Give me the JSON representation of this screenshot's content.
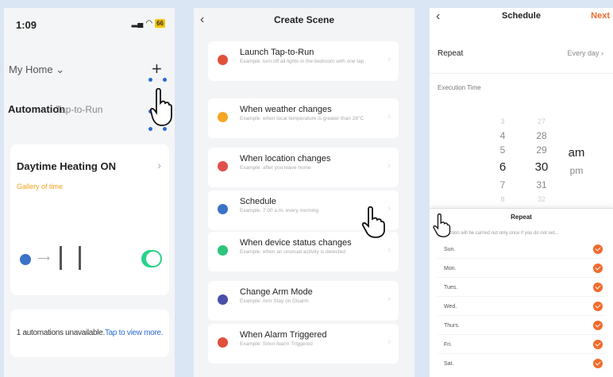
{
  "screen1": {
    "time": "1:09",
    "battery": "66",
    "home_label": "My Home",
    "add_icon": "+",
    "tabs": [
      "Automation",
      "Tap-to-Run"
    ],
    "automation": {
      "title": "Daytime Heating ON",
      "subtitle": "Gallery of time",
      "toggle_on": true
    },
    "unavailable": "1 automations unavailable.",
    "view_more": "Tap to view more."
  },
  "screen2": {
    "title": "Create Scene",
    "items": [
      {
        "title": "Launch Tap-to-Run",
        "desc": "Example: turn off all lights in the bedroom with one tap",
        "icon": "tap-icon",
        "color": "#e0503a"
      },
      {
        "title": "When weather changes",
        "desc": "Example: when local temperature is greater than 28°C",
        "icon": "sun-icon",
        "color": "#f5a623"
      },
      {
        "title": "When location changes",
        "desc": "Example: after you leave home",
        "icon": "location-icon",
        "color": "#e0504a"
      },
      {
        "title": "Schedule",
        "desc": "Example: 7:00 a.m. every morning",
        "icon": "clock-icon",
        "color": "#3a72c7"
      },
      {
        "title": "When device status changes",
        "desc": "Example: when an unusual activity is detected",
        "icon": "device-icon",
        "color": "#2bc47a"
      },
      {
        "title": "Change Arm Mode",
        "desc": "Example: Arm Stay on Disarm",
        "icon": "shield-icon",
        "color": "#4a4fa8"
      },
      {
        "title": "When Alarm Triggered",
        "desc": "Example: Siren Alarm Triggered",
        "icon": "alarm-icon",
        "color": "#e0503a"
      }
    ]
  },
  "screen3": {
    "title": "Schedule",
    "next": "Next",
    "repeat_label": "Repeat",
    "repeat_value": "Every day",
    "execution_time": "Execution Time",
    "hours": [
      "4",
      "5",
      "6",
      "7",
      "8"
    ],
    "minutes": [
      "28",
      "29",
      "30",
      "31",
      "32"
    ],
    "ampm": [
      "am",
      "pm"
    ],
    "selected": {
      "hour": "6",
      "minute": "30",
      "ampm": "am"
    },
    "sheet": {
      "title": "Repeat",
      "note": "...ction will be carried out only once if you do not set...",
      "days": [
        "Sun.",
        "Mon.",
        "Tues.",
        "Wed.",
        "Thurs.",
        "Fri.",
        "Sat."
      ]
    }
  },
  "colors": {
    "accent": "#f26a2b",
    "link": "#2a6bd1",
    "toggle": "#2bd18a"
  }
}
